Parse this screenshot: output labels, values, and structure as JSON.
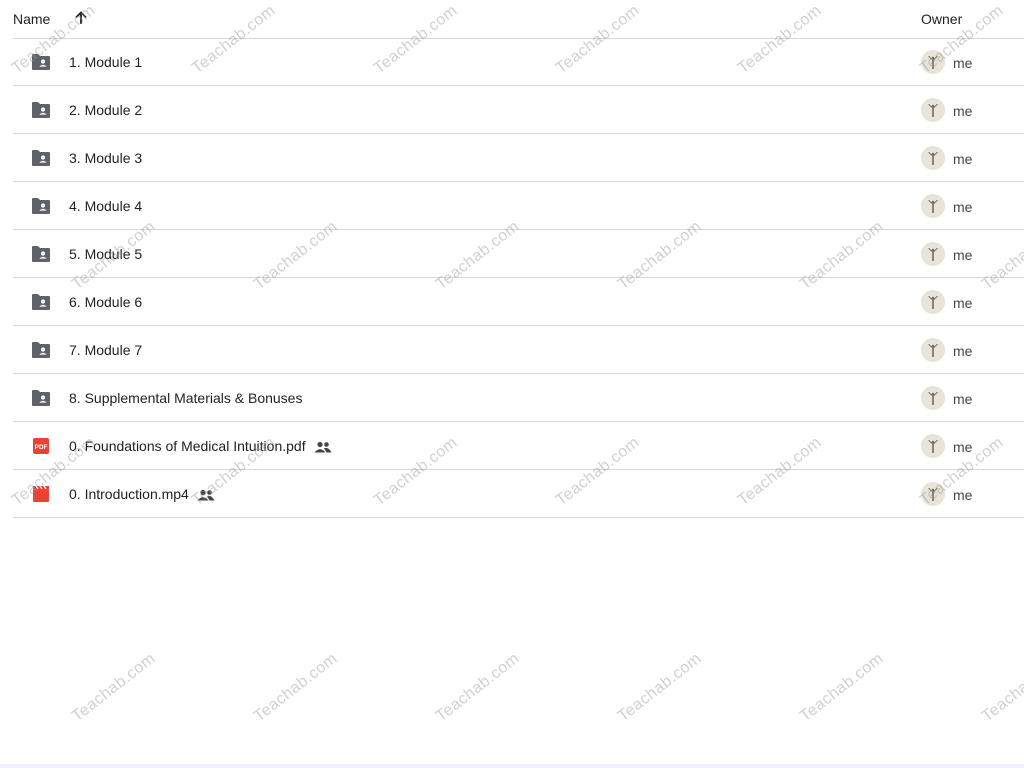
{
  "header": {
    "name_label": "Name",
    "owner_label": "Owner",
    "sort_icon": "arrow-up-icon"
  },
  "files": [
    {
      "name": "1. Module 1",
      "type": "folder",
      "owner": "me",
      "shared": false
    },
    {
      "name": "2. Module 2",
      "type": "folder",
      "owner": "me",
      "shared": false
    },
    {
      "name": "3. Module 3",
      "type": "folder",
      "owner": "me",
      "shared": false
    },
    {
      "name": "4. Module 4",
      "type": "folder",
      "owner": "me",
      "shared": false
    },
    {
      "name": "5. Module 5",
      "type": "folder",
      "owner": "me",
      "shared": false
    },
    {
      "name": "6. Module 6",
      "type": "folder",
      "owner": "me",
      "shared": false
    },
    {
      "name": "7. Module 7",
      "type": "folder",
      "owner": "me",
      "shared": false
    },
    {
      "name": "8. Supplemental Materials & Bonuses",
      "type": "folder",
      "owner": "me",
      "shared": false
    },
    {
      "name": "0. Foundations of Medical Intuition.pdf",
      "type": "pdf",
      "owner": "me",
      "shared": true,
      "badge": "PDF"
    },
    {
      "name": "0. Introduction.mp4",
      "type": "video",
      "owner": "me",
      "shared": true
    }
  ],
  "watermark": "Teachab.com",
  "colors": {
    "folder": "#5f6368",
    "pdf": "#ea4335",
    "video": "#ea4335",
    "divider": "#d7d7d7"
  }
}
